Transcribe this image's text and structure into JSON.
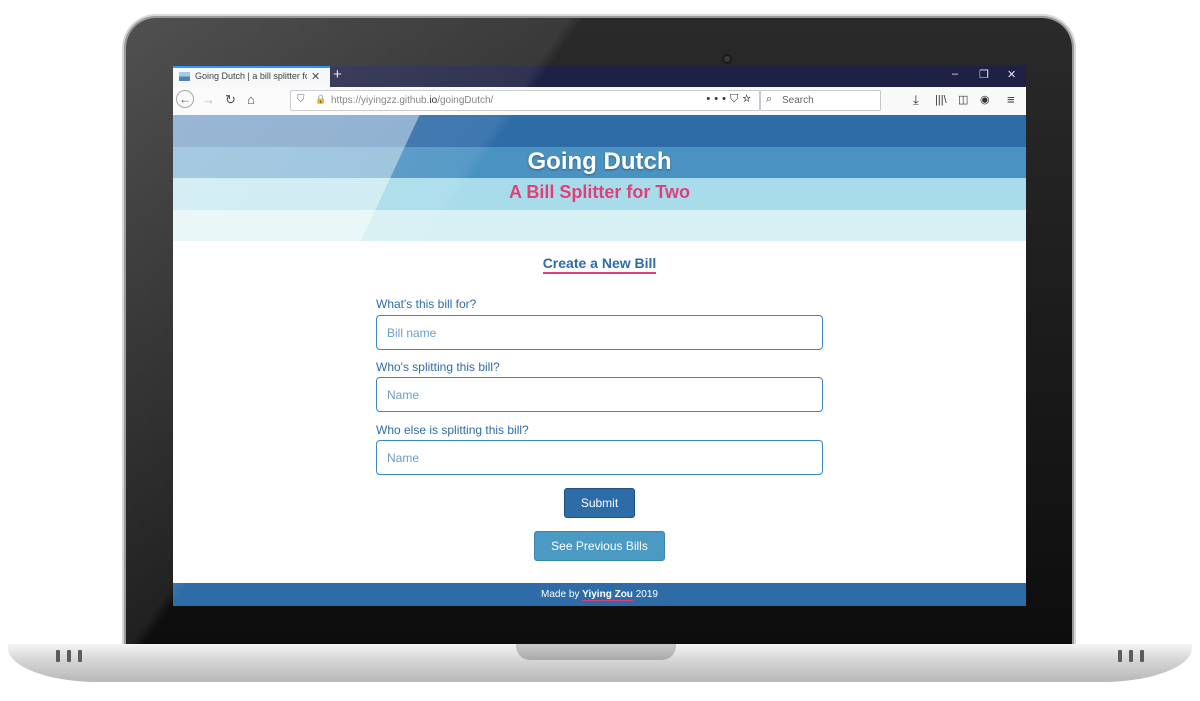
{
  "browser": {
    "tab_title": "Going Dutch | a bill splitter for",
    "url_prefix": "https://yiyingzz.github.",
    "url_domain": "io",
    "url_path": "/goingDutch/",
    "search_placeholder": "Search"
  },
  "banner": {
    "title": "Going Dutch",
    "subtitle": "A Bill Splitter for Two",
    "stripe_colors": [
      "#2e6ca8",
      "#4a92c2",
      "#a8dcea",
      "#d6f0f3"
    ]
  },
  "form": {
    "heading": "Create a New Bill",
    "fields": [
      {
        "label": "What's this bill for?",
        "placeholder": "Bill name"
      },
      {
        "label": "Who's splitting this bill?",
        "placeholder": "Name"
      },
      {
        "label": "Who else is splitting this bill?",
        "placeholder": "Name"
      }
    ],
    "submit_label": "Submit",
    "previous_label": "See Previous Bills"
  },
  "footer": {
    "prefix": "Made by",
    "author": "Yiying Zou",
    "year": "2019"
  },
  "colors": {
    "primary": "#2e6ca8",
    "accent": "#e0407a",
    "secondary_button": "#4a9ac4"
  }
}
